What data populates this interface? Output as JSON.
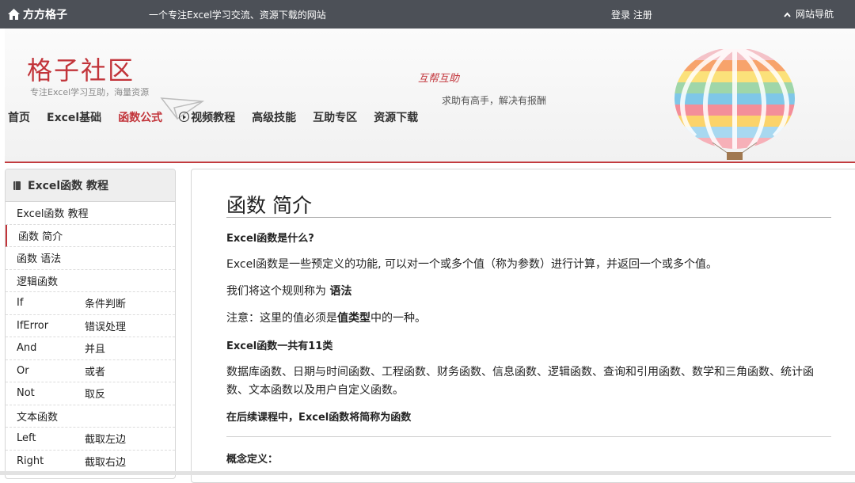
{
  "topbar": {
    "logo": "方方格子",
    "tagline": "一个专注Excel学习交流、资源下载的网站",
    "login": "登录",
    "register": "注册",
    "site_nav": "网站导航"
  },
  "banner": {
    "brand": "格子社区",
    "brand_sub": "专注Excel学习互助，海量资源",
    "slogan1": "互帮互助",
    "slogan2": "求助有高手，解决有报酬"
  },
  "nav": {
    "items": [
      {
        "label": "首页"
      },
      {
        "label": "Excel基础"
      },
      {
        "label": "函数公式"
      },
      {
        "label": "视频教程"
      },
      {
        "label": "高级技能"
      },
      {
        "label": "互助专区"
      },
      {
        "label": "资源下载"
      }
    ],
    "active_index": 2
  },
  "sidebar": {
    "title": "Excel函数 教程",
    "rows": [
      {
        "name": "Excel函数 教程",
        "desc": ""
      },
      {
        "name": "函数 简介",
        "desc": ""
      },
      {
        "name": "函数 语法",
        "desc": ""
      },
      {
        "name": "逻辑函数",
        "desc": ""
      },
      {
        "name": "If",
        "desc": "条件判断"
      },
      {
        "name": "IfError",
        "desc": "错误处理"
      },
      {
        "name": "And",
        "desc": "并且"
      },
      {
        "name": "Or",
        "desc": "或者"
      },
      {
        "name": "Not",
        "desc": "取反"
      },
      {
        "name": "文本函数",
        "desc": ""
      },
      {
        "name": "Left",
        "desc": "截取左边"
      },
      {
        "name": "Right",
        "desc": "截取右边"
      }
    ]
  },
  "content": {
    "title": "函数 简介",
    "q1": "Excel函数是什么?",
    "p1": "Excel函数是一些预定义的功能, 可以对一个或多个值（称为参数）进行计算，并返回一个或多个值。",
    "p2_prefix": "我们将这个规则称为 ",
    "p2_bold": "语法",
    "p3_prefix": "注意：这里的值必须是",
    "p3_bold": "值类型",
    "p3_suffix": "中的一种。",
    "q2": "Excel函数一共有11类",
    "p4": "数据库函数、日期与时间函数、工程函数、财务函数、信息函数、逻辑函数、查询和引用函数、数学和三角函数、统计函数、文本函数以及用户自定义函数。",
    "note": "在后续课程中，Excel函数将简称为函数",
    "concept": "概念定义："
  },
  "colors": {
    "accent": "#c2343a",
    "topbar": "#4c5057"
  },
  "icons": [
    "home-icon",
    "chevron-up-icon",
    "paper-plane-icon",
    "hot-air-balloon-icon",
    "play-circle-icon",
    "book-icon"
  ]
}
